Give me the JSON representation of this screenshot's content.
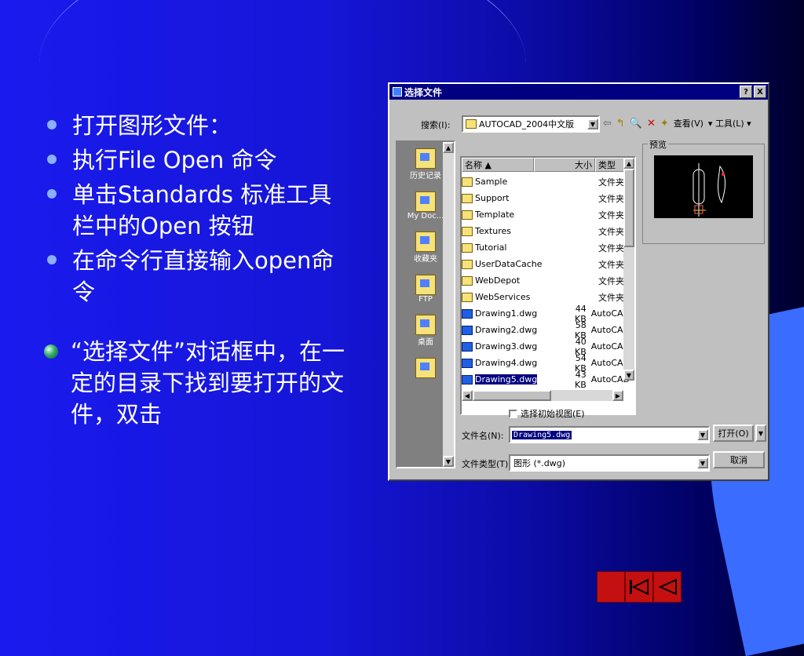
{
  "slide": {
    "bullets": [
      {
        "text": "打开图形文件："
      },
      {
        "text": "执行File Open 命令"
      },
      {
        "text": "单击Standards 标准工具栏中的Open 按钮"
      },
      {
        "text": "在命令行直接输入open命令"
      }
    ],
    "note": "“选择文件”对话框中，在一定的目录下找到要打开的文件，双击"
  },
  "dialog": {
    "title": "选择文件",
    "help_btn": "?",
    "close_btn": "X",
    "search_label": "搜索(I):",
    "search_value": "AUTOCAD_2004中文版",
    "view_menu": "查看(V)",
    "tools_menu": "工具(L)",
    "places": [
      "历史记录",
      "My Doc...",
      "收藏夹",
      "FTP",
      "桌面"
    ],
    "columns": {
      "name": "名称",
      "size": "大小",
      "type": "类型"
    },
    "files": [
      {
        "name": "Sample",
        "size": "",
        "type": "文件夹",
        "kind": "folder"
      },
      {
        "name": "Support",
        "size": "",
        "type": "文件夹",
        "kind": "folder"
      },
      {
        "name": "Template",
        "size": "",
        "type": "文件夹",
        "kind": "folder"
      },
      {
        "name": "Textures",
        "size": "",
        "type": "文件夹",
        "kind": "folder"
      },
      {
        "name": "Tutorial",
        "size": "",
        "type": "文件夹",
        "kind": "folder"
      },
      {
        "name": "UserDataCache",
        "size": "",
        "type": "文件夹",
        "kind": "folder"
      },
      {
        "name": "WebDepot",
        "size": "",
        "type": "文件夹",
        "kind": "folder"
      },
      {
        "name": "WebServices",
        "size": "",
        "type": "文件夹",
        "kind": "folder"
      },
      {
        "name": "Drawing1.dwg",
        "size": "44 KB",
        "type": "AutoCAD",
        "kind": "dwg"
      },
      {
        "name": "Drawing2.dwg",
        "size": "58 KB",
        "type": "AutoCAD",
        "kind": "dwg"
      },
      {
        "name": "Drawing3.dwg",
        "size": "40 KB",
        "type": "AutoCAD",
        "kind": "dwg"
      },
      {
        "name": "Drawing4.dwg",
        "size": "54 KB",
        "type": "AutoCAD",
        "kind": "dwg"
      },
      {
        "name": "Drawing5.dwg",
        "size": "43 KB",
        "type": "AutoCAD",
        "kind": "dwg",
        "selected": true
      }
    ],
    "preview_label": "预览",
    "initial_view_label": "选择初始视图(E)",
    "filename_label": "文件名(N):",
    "filename_value": "Drawing5.dwg",
    "filetype_label": "文件类型(T):",
    "filetype_value": "图形 (*.dwg)",
    "open_btn": "打开(O)",
    "cancel_btn": "取消"
  }
}
